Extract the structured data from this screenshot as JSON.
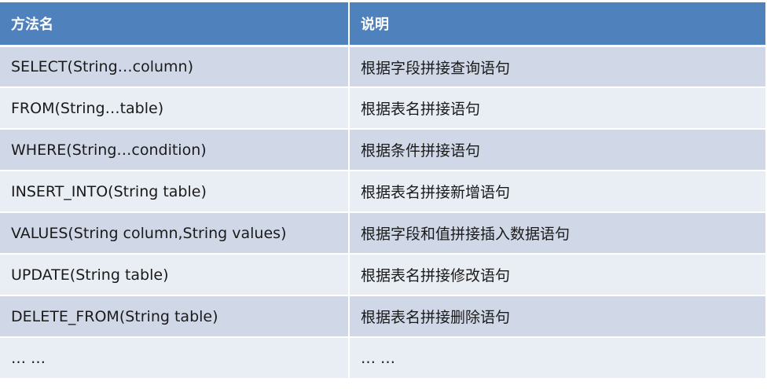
{
  "header": {
    "col1": "方法名",
    "col2": "说明"
  },
  "rows": [
    {
      "method": "SELECT(String…column)",
      "desc": "根据字段拼接查询语句"
    },
    {
      "method": "FROM(String…table)",
      "desc": "根据表名拼接语句"
    },
    {
      "method": "WHERE(String…condition)",
      "desc": "根据条件拼接语句"
    },
    {
      "method": "INSERT_INTO(String table)",
      "desc": "根据表名拼接新增语句"
    },
    {
      "method": "VALUES(String column,String values)",
      "desc": "根据字段和值拼接插入数据语句"
    },
    {
      "method": "UPDATE(String table)",
      "desc": "根据表名拼接修改语句"
    },
    {
      "method": "DELETE_FROM(String table)",
      "desc": "根据表名拼接删除语句"
    },
    {
      "method": "… …",
      "desc": "… …"
    }
  ],
  "colors": {
    "header_bg": "#4f81bd",
    "row_odd_bg": "#d0d8e8",
    "row_even_bg": "#e9edf4"
  }
}
